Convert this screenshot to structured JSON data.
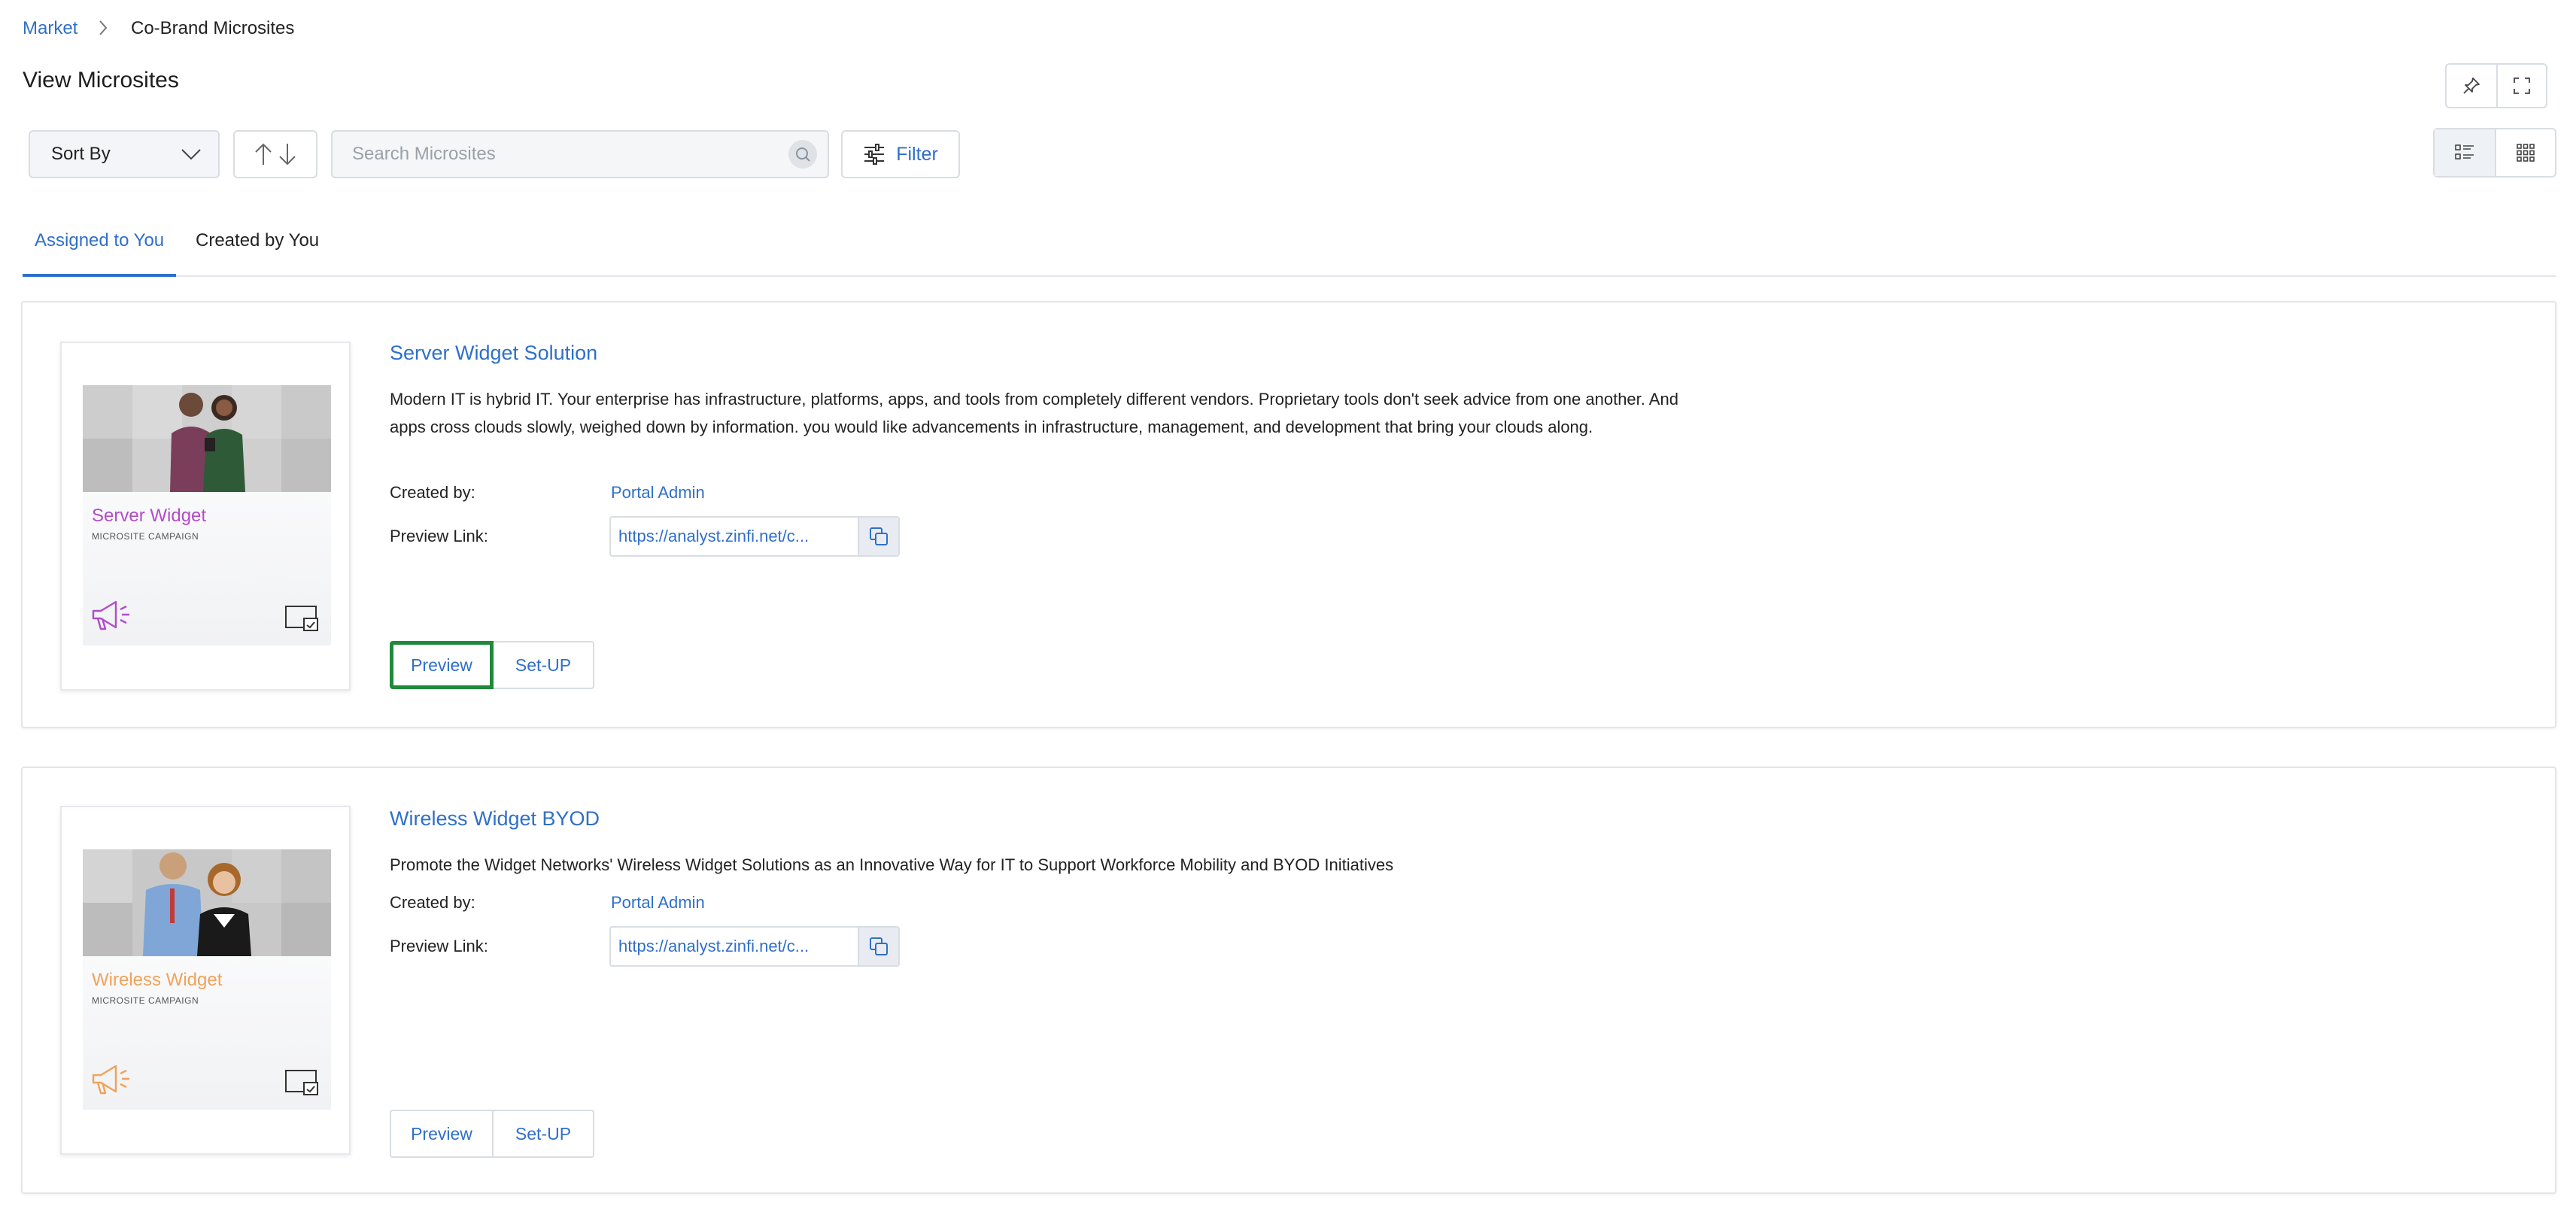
{
  "breadcrumb": {
    "root": "Market",
    "current": "Co-Brand Microsites"
  },
  "page": {
    "title": "View Microsites"
  },
  "toolbar": {
    "sort_label": "Sort By",
    "search_placeholder": "Search Microsites",
    "search_value": "",
    "filter_label": "Filter"
  },
  "tabs": [
    {
      "label": "Assigned to You",
      "active": true
    },
    {
      "label": "Created by You",
      "active": false
    }
  ],
  "microsites": [
    {
      "title": "Server Widget Solution",
      "description": "Modern IT is hybrid IT. Your enterprise has infrastructure, platforms, apps, and tools from completely different vendors. Proprietary tools don't seek advice from one another. And apps cross clouds slowly, weighed down by information. you would like advancements in infrastructure, management, and development that bring your clouds along.",
      "created_by_label": "Created by:",
      "created_by": "Portal Admin",
      "preview_link_label": "Preview Link:",
      "preview_link": "https://analyst.zinfi.net/c...",
      "thumb_name": "Server Widget",
      "thumb_sub": "MICROSITE CAMPAIGN",
      "thumb_color": "#b04cc9",
      "preview_label": "Preview",
      "setup_label": "Set-UP"
    },
    {
      "title": "Wireless Widget BYOD",
      "description": "Promote the Widget Networks' Wireless Widget Solutions as an Innovative Way for IT to Support Workforce Mobility and BYOD Initiatives",
      "created_by_label": "Created by:",
      "created_by": "Portal Admin",
      "preview_link_label": "Preview Link:",
      "preview_link": "https://analyst.zinfi.net/c...",
      "thumb_name": "Wireless Widget",
      "thumb_sub": "MICROSITE CAMPAIGN",
      "thumb_color": "#f0a25a",
      "preview_label": "Preview",
      "setup_label": "Set-UP"
    }
  ],
  "colors": {
    "accent": "#2f6fc9",
    "focus_outline": "#1f8a3a"
  }
}
